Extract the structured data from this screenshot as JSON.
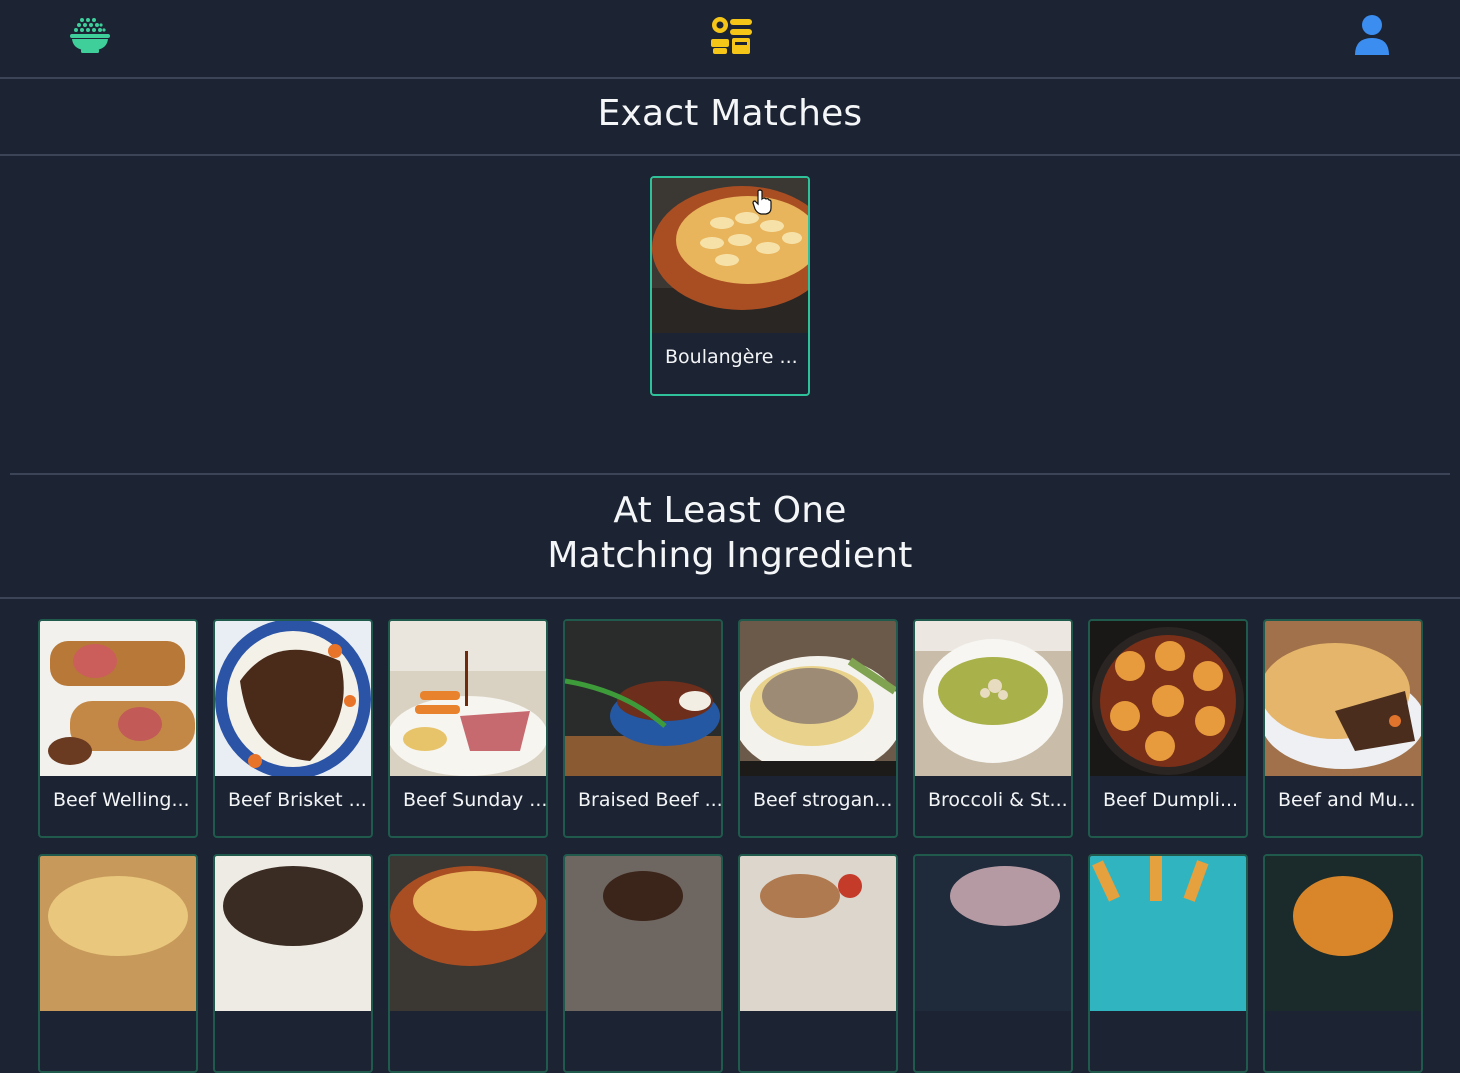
{
  "header": {
    "logo_icon": "rice-bowl-icon",
    "center_icon": "ingredients-filter-icon",
    "user_icon": "user-profile-icon",
    "logo_color": "#3ecf9b",
    "center_color": "#f5c518",
    "user_color": "#3b8ef0"
  },
  "exact": {
    "title": "Exact Matches",
    "cards": [
      {
        "label": "Boulangère ..."
      }
    ]
  },
  "partial": {
    "title_line1": "At Least One",
    "title_line2": "Matching Ingredient",
    "cards": [
      {
        "label": "Beef Welling..."
      },
      {
        "label": "Beef Brisket ..."
      },
      {
        "label": "Beef Sunday ..."
      },
      {
        "label": "Braised Beef ..."
      },
      {
        "label": "Beef strogan..."
      },
      {
        "label": "Broccoli & St..."
      },
      {
        "label": "Beef Dumpli..."
      },
      {
        "label": "Beef and Mu..."
      }
    ]
  },
  "colors": {
    "background": "#1c2333",
    "card_border": "#1f5a4c",
    "card_border_active": "#2fc29a",
    "divider": "#3c4557"
  }
}
